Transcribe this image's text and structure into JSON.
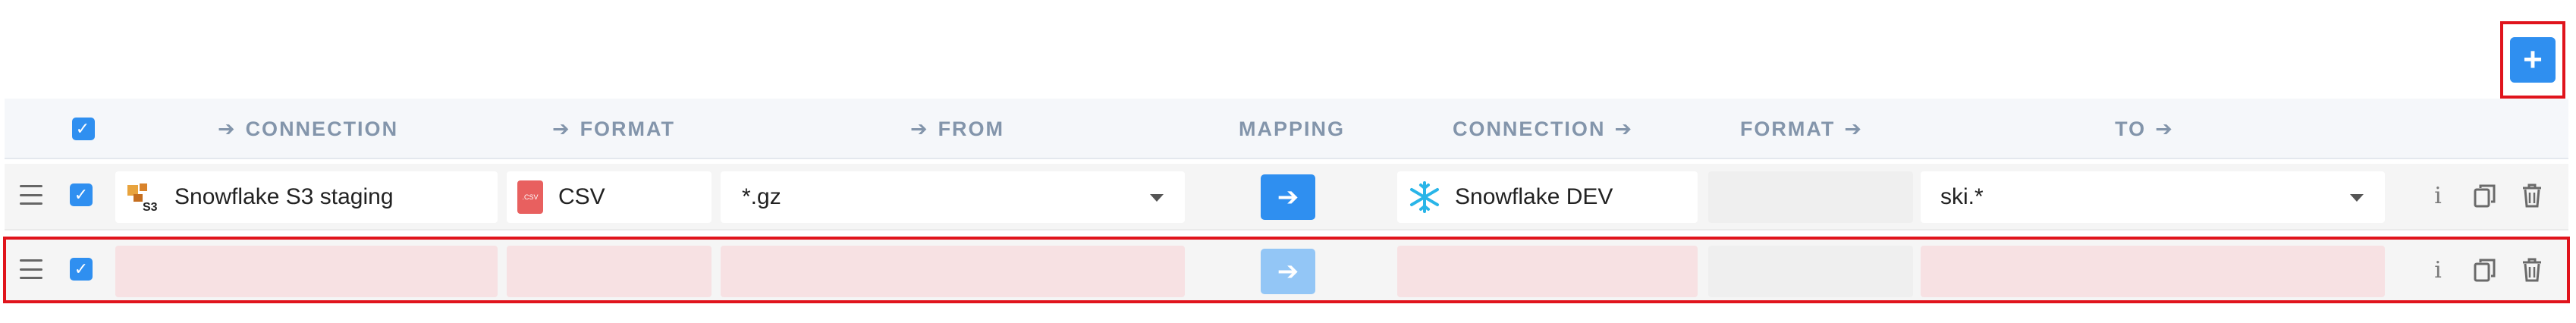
{
  "add_button": {
    "label": "+"
  },
  "header": {
    "connection_src": "CONNECTION",
    "format_src": "FORMAT",
    "from": "FROM",
    "mapping": "MAPPING",
    "connection_dst": "CONNECTION",
    "format_dst": "FORMAT",
    "to": "TO",
    "arrow": "➔"
  },
  "rows": [
    {
      "checked": true,
      "source_connection": "Snowflake S3 staging",
      "source_format": "CSV",
      "from": "*.gz",
      "destination_connection": "Snowflake DEV",
      "destination_format": "",
      "to": "ski.*",
      "mapping_icon": "arrow-right-icon"
    },
    {
      "checked": true,
      "source_connection": "",
      "source_format": "",
      "from": "",
      "destination_connection": "",
      "destination_format": "",
      "to": "",
      "mapping_icon": "arrow-right-icon"
    }
  ],
  "icons": {
    "check": "✓",
    "mapping": "➔",
    "info": "i"
  },
  "colors": {
    "accent": "#2f8ff0",
    "highlight_border": "#e0141c",
    "empty_required": "#f7e1e3"
  }
}
